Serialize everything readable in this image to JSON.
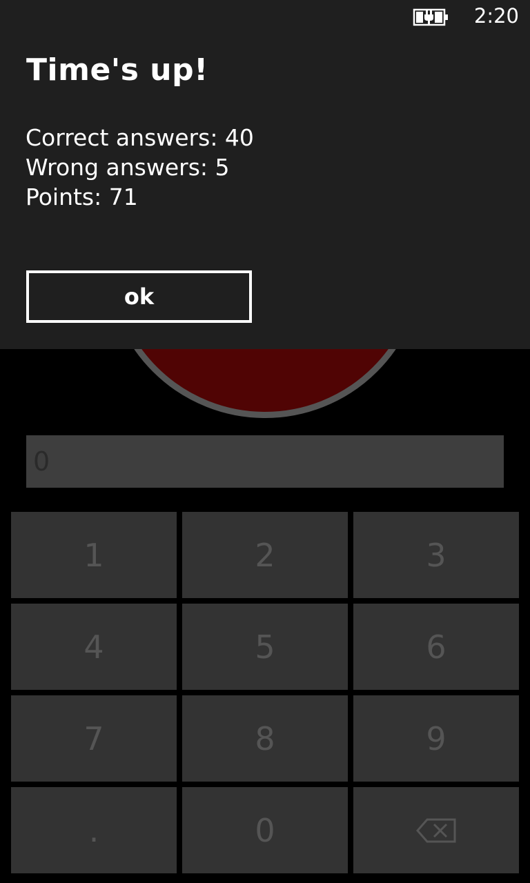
{
  "status_bar": {
    "battery_icon": "battery-charging-icon",
    "time": "2:20"
  },
  "dialog": {
    "title": "Time's up!",
    "correct_answers": "Correct answers: 40",
    "wrong_answers": "Wrong answers: 5",
    "points": "Points: 71",
    "ok_label": "ok"
  },
  "game": {
    "answer_value": "0",
    "timer_color": "#500404",
    "keypad": {
      "rows": [
        [
          "1",
          "2",
          "3"
        ],
        [
          "4",
          "5",
          "6"
        ],
        [
          "7",
          "8",
          "9"
        ],
        [
          ".",
          "0",
          "backspace-icon"
        ]
      ]
    }
  },
  "colors": {
    "dialog_background": "#1f1f1f",
    "app_background": "#000000",
    "key_background": "#333333",
    "key_text": "#555555"
  }
}
